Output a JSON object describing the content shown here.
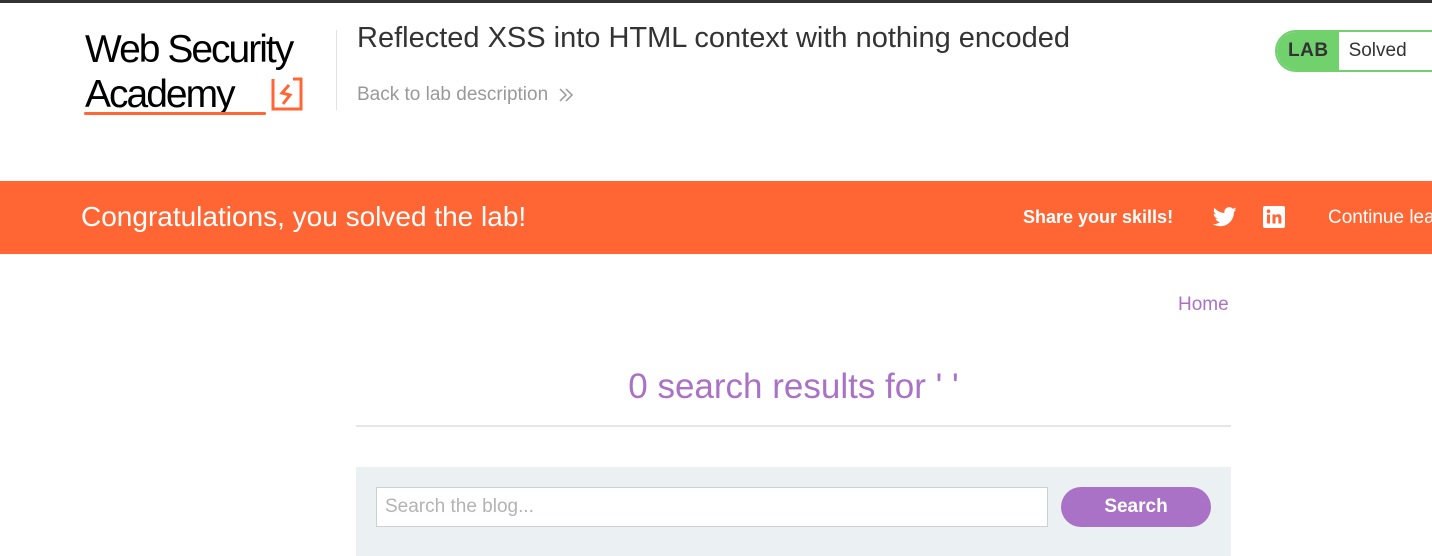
{
  "logo": {
    "line1": "Web Security",
    "line2": "Academy"
  },
  "header": {
    "title": "Reflected XSS into HTML context with nothing encoded",
    "back_link": "Back to lab description",
    "status": {
      "badge": "LAB",
      "text": "Solved"
    }
  },
  "banner": {
    "message": "Congratulations, you solved the lab!",
    "share_label": "Share your skills!",
    "continue_label": "Continue lea"
  },
  "nav": {
    "home": "Home"
  },
  "main": {
    "results_heading": "0 search results for ' '",
    "search": {
      "placeholder": "Search the blog...",
      "value": "",
      "button": "Search"
    }
  },
  "colors": {
    "accent_orange": "#ff6633",
    "link_purple": "#aa72c6",
    "solved_green": "#70d16d",
    "search_panel_bg": "#ebf0f2"
  },
  "icons": [
    "logo-mark-icon",
    "double-chevron-right-icon",
    "twitter-icon",
    "linkedin-icon"
  ]
}
